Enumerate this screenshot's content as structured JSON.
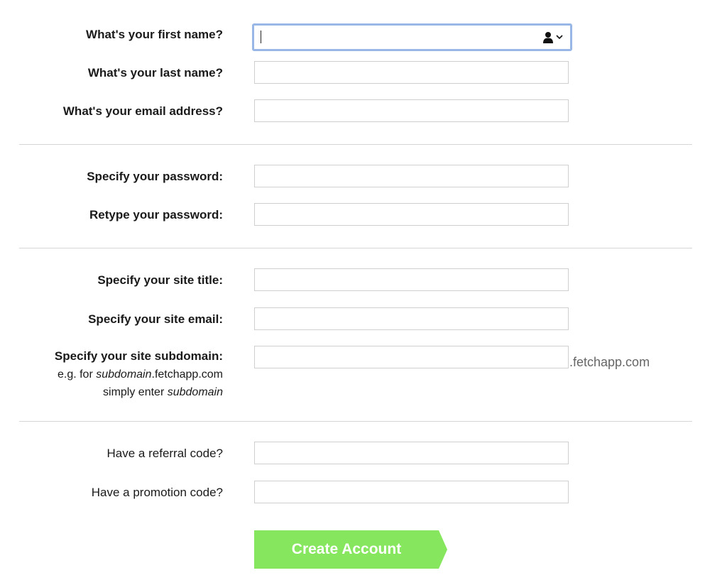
{
  "colors": {
    "button": "#86e65e",
    "focus_ring": "#98b6e6",
    "divider": "#d6d6d6",
    "suffix": "#666666"
  },
  "section_personal": {
    "first_name_label": "What's your first name?",
    "first_name_value": "",
    "last_name_label": "What's your last name?",
    "email_label": "What's your email address?"
  },
  "section_password": {
    "password_label": "Specify your password:",
    "retype_label": "Retype your password:"
  },
  "section_site": {
    "title_label": "Specify your site title:",
    "email_label": "Specify your site email:",
    "subdomain_label": "Specify your site subdomain:",
    "hint_prefix": "e.g. for ",
    "hint_em": "subdomain",
    "hint_suffix": ".fetchapp.com",
    "hint_line2_prefix": "simply enter ",
    "hint_line2_em": "subdomain",
    "domain_suffix": ".fetchapp.com"
  },
  "section_codes": {
    "referral_label": "Have a referral code?",
    "promotion_label": "Have a promotion code?"
  },
  "submit": {
    "label": "Create Account"
  },
  "icons": {
    "autofill": "person-icon",
    "autofill_arrow": "chevron-down-icon"
  }
}
